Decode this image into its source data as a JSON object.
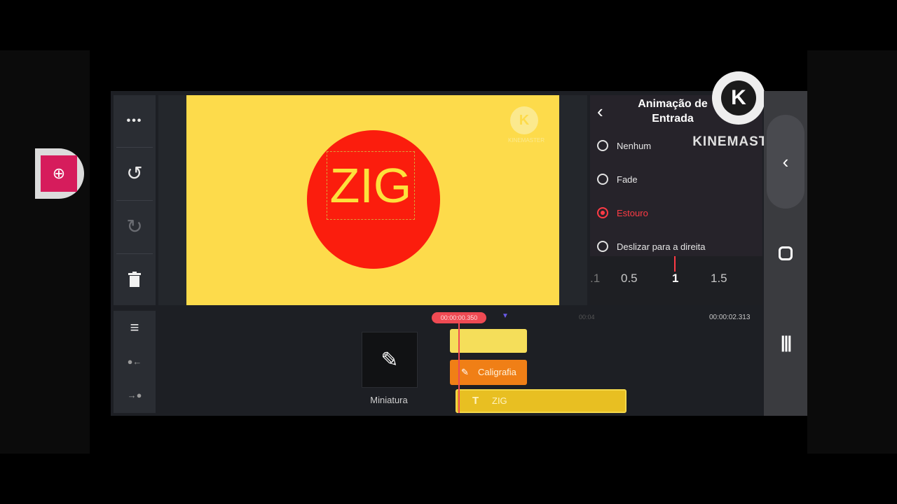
{
  "left_toolbar": {
    "more_icon": "•••",
    "undo_icon": "↺",
    "redo_icon": "↻",
    "delete_icon": "🗑"
  },
  "left_toolbar2": {
    "split_icon": "≡",
    "trim_left_icon": "●←",
    "trim_right_icon": "→●"
  },
  "preview": {
    "text": "ZIG",
    "background_color": "#fddb4b",
    "circle_color": "#fb1d0d",
    "watermark_logo": "K",
    "watermark_text": "KINEMASTER"
  },
  "panel": {
    "back_icon": "‹",
    "title": "Animação de Entrada",
    "options": [
      {
        "label": "Nenhum",
        "selected": false
      },
      {
        "label": "Fade",
        "selected": false
      },
      {
        "label": "Estouro",
        "selected": true
      },
      {
        "label": "Deslizar para a direita",
        "selected": false
      }
    ],
    "dial": ".1|0.5|1|1.5"
  },
  "dial_values": {
    "a": ".1",
    "b": "0.5",
    "c": "1",
    "d": "1.5"
  },
  "kinemaster_overlay": {
    "logo": "K",
    "text": "KINEMASTER"
  },
  "navbar": {
    "back": "‹",
    "recent": "|||"
  },
  "timeline": {
    "current_time": "00:00:00.350",
    "mid_time": "00:04",
    "end_time": "00:00:02.313",
    "thumbnail_icon": "✎",
    "thumbnail_label": "Miniatura",
    "clip_caligrafia": "Caligrafia",
    "clip_text": "ZIG",
    "clip_text_icon": "T"
  },
  "zoom_icon": "⊕"
}
